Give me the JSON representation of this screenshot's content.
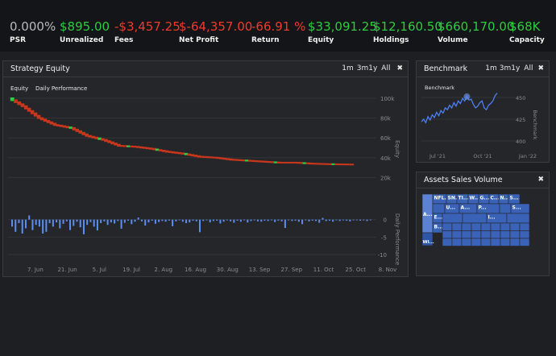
{
  "stats": [
    {
      "value": "0.000%",
      "label": "PSR",
      "color": "#b9b9b9"
    },
    {
      "value": "$895.00",
      "label": "Unrealized",
      "color": "#2ecc40"
    },
    {
      "value": "-$3,457.25",
      "label": "Fees",
      "color": "#ef3a2c"
    },
    {
      "value": "$-64,357.00",
      "label": "Net Profit",
      "color": "#ef3a2c"
    },
    {
      "value": "-66.91 %",
      "label": "Return",
      "color": "#ef3a2c"
    },
    {
      "value": "$33,091.25",
      "label": "Equity",
      "color": "#2ecc40"
    },
    {
      "value": "$12,160.50",
      "label": "Holdings",
      "color": "#2ecc40"
    },
    {
      "value": "$660,170.00",
      "label": "Volume",
      "color": "#2ecc40"
    },
    {
      "value": "$68K",
      "label": "Capacity",
      "color": "#2ecc40"
    }
  ],
  "strategy_panel": {
    "title": "Strategy Equity",
    "range_buttons": [
      "1m",
      "3m",
      "1y",
      "All"
    ],
    "close_icon": "✖",
    "legend_equity": "Equity",
    "legend_daily": "Daily Performance"
  },
  "benchmark_panel": {
    "title": "Benchmark",
    "range_buttons": [
      "1m",
      "3m",
      "1y",
      "All"
    ],
    "close_icon": "✖",
    "chart_label": "Benchmark"
  },
  "assets_panel": {
    "title": "Assets Sales Volume",
    "close_icon": "✖",
    "cells": [
      "NFL...",
      "SN...",
      "TI...",
      "W...",
      "G...",
      "C...",
      "N...",
      "S...",
      "A...",
      "U...",
      "A...",
      "P...",
      "S...",
      "E...",
      "I...",
      "B...",
      "WI..."
    ]
  },
  "colors": {
    "up": "#2ecc40",
    "down": "#ef3a2c",
    "equity_line": "#c8361c",
    "daily_bar": "#5b8def",
    "benchmark_line": "#4d7ff0",
    "treemap": "#3a63b8"
  },
  "chart_data": [
    {
      "type": "line",
      "title": "Strategy Equity",
      "series": [
        {
          "name": "Equity",
          "x": [
            "2021-06-01",
            "2021-06-07",
            "2021-06-14",
            "2021-06-21",
            "2021-06-28",
            "2021-07-05",
            "2021-07-12",
            "2021-07-19",
            "2021-07-26",
            "2021-08-02",
            "2021-08-09",
            "2021-08-16",
            "2021-08-23",
            "2021-08-30",
            "2021-09-06",
            "2021-09-13",
            "2021-09-20",
            "2021-09-27",
            "2021-10-04",
            "2021-10-11",
            "2021-10-18",
            "2021-10-25",
            "2021-10-29"
          ],
          "values": [
            100000,
            92000,
            80000,
            73000,
            70000,
            62000,
            58000,
            52000,
            51000,
            49000,
            46000,
            44000,
            41000,
            40000,
            38000,
            37000,
            36000,
            35000,
            35000,
            34000,
            33500,
            33200,
            33100
          ]
        }
      ],
      "xticks": [
        "7. Jun",
        "21. Jun",
        "5. Jul",
        "19. Jul",
        "2. Aug",
        "16. Aug",
        "30. Aug",
        "13. Sep",
        "27. Sep",
        "11. Oct",
        "25. Oct",
        "8. Nov"
      ],
      "ylabel": "Equity",
      "yticks": [
        "100k",
        "80k",
        "60k",
        "40k",
        "20k"
      ],
      "ylim": [
        0,
        100000
      ]
    },
    {
      "type": "bar",
      "title": "",
      "ylabel": "Daily Performance",
      "yticks": [
        "0",
        "-5",
        "-10"
      ],
      "ylim": [
        -10,
        2
      ],
      "series": [
        {
          "name": "Daily Performance",
          "values": [
            -2,
            -3.5,
            -1,
            -4,
            -2.5,
            1.2,
            -3,
            -1.5,
            -2,
            -4,
            -3.5,
            -1,
            -2,
            -0.8,
            -2.5,
            -1.2,
            -0.5,
            -3,
            -1.8,
            -0.6,
            -2.2,
            -4.2,
            -1.5,
            -0.7,
            -2,
            -3.1,
            -1,
            -0.5,
            -1.5,
            -0.8,
            -1.1,
            -0.4,
            -2.6,
            -0.9,
            -0.3,
            -1.3,
            -0.6,
            0.6,
            -0.5,
            -1.7,
            -0.8,
            -0.3,
            -1.2,
            -0.7,
            -0.4,
            -0.6,
            -0.3,
            -1.9,
            -0.5,
            -0.2,
            -0.6,
            -1,
            -0.8,
            -0.3,
            -0.5,
            -3.6,
            -0.4,
            -0.2,
            -0.8,
            -0.4,
            -0.3,
            -1.1,
            -0.6,
            -0.2,
            -0.5,
            -0.9,
            -0.3,
            -0.6,
            -0.2,
            -0.8,
            -0.4,
            -0.2,
            -0.5,
            -0.6,
            -0.3,
            -0.4,
            -0.2,
            -0.7,
            -0.3,
            -0.5,
            -2.4,
            -0.2,
            -0.4,
            -0.3,
            -0.6,
            -1.3,
            -0.2,
            -0.5,
            -0.3,
            -0.4,
            -0.9,
            0.5,
            -0.4,
            -0.3,
            -0.6,
            -0.2,
            -0.4,
            -0.2,
            -0.3,
            -0.5,
            -0.2,
            -0.1,
            -0.3,
            -0.2,
            -0.4,
            -0.2
          ]
        }
      ]
    },
    {
      "type": "line",
      "title": "Benchmark",
      "ylabel": "Benchmark",
      "xticks": [
        "Jul '21",
        "Oct '21",
        "Jan '22"
      ],
      "yticks": [
        "450",
        "425",
        "400"
      ],
      "ylim": [
        395,
        460
      ],
      "series": [
        {
          "name": "Benchmark",
          "values": [
            422,
            425,
            421,
            428,
            424,
            430,
            427,
            433,
            429,
            435,
            432,
            438,
            436,
            441,
            438,
            444,
            440,
            446,
            443,
            449,
            446,
            451,
            447,
            448,
            442,
            438,
            440,
            444,
            446,
            438,
            436,
            441,
            443,
            446,
            452,
            455
          ]
        }
      ]
    }
  ]
}
